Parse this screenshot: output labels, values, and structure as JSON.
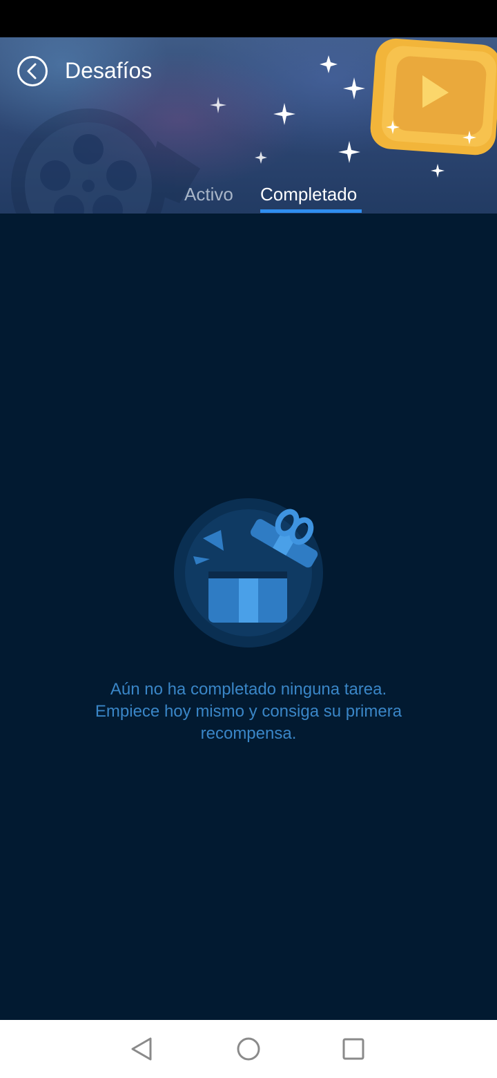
{
  "header": {
    "title": "Desafíos",
    "back_icon": "back-arrow-icon",
    "accent_color": "#2f8ef0"
  },
  "tabs": [
    {
      "label": "Activo",
      "selected": false
    },
    {
      "label": "Completado",
      "selected": true
    }
  ],
  "empty_state": {
    "icon": "gift-box-icon",
    "lines": [
      "Aún no ha completado ninguna tarea.",
      "Empiece hoy mismo y consiga su primera",
      "recompensa."
    ]
  },
  "navigation_bar": {
    "back_icon": "nav-back-icon",
    "home_icon": "nav-home-icon",
    "recents_icon": "nav-recents-icon"
  }
}
